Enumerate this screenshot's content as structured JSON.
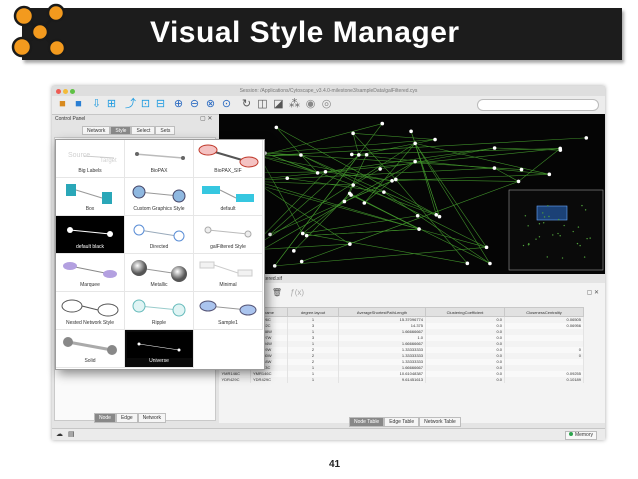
{
  "slide": {
    "title": "Visual Style Manager",
    "page_number": "41"
  },
  "window": {
    "title": "Session: /Applications/Cytoscape_v3.4.0-milestone3/sampleData/galFiltered.cys"
  },
  "control_panel": {
    "label": "Control Panel",
    "tabs": [
      "Network",
      "Style",
      "Select",
      "Sets"
    ],
    "bottom_tabs": [
      "Node",
      "Edge",
      "Network"
    ]
  },
  "styles": [
    {
      "label": "Big Labels",
      "preview": "big-labels"
    },
    {
      "label": "BioPAX",
      "preview": "biopax"
    },
    {
      "label": "BioPAX_SIF",
      "preview": "biopax-sif"
    },
    {
      "label": "Box",
      "preview": "box"
    },
    {
      "label": "Custom Graphics Style",
      "preview": "custom-graphics"
    },
    {
      "label": "default",
      "preview": "default"
    },
    {
      "label": "default black",
      "preview": "default-black"
    },
    {
      "label": "Directed",
      "preview": "directed"
    },
    {
      "label": "galFiltered Style",
      "preview": "galfiltered"
    },
    {
      "label": "Marquee",
      "preview": "marquee"
    },
    {
      "label": "Metallic",
      "preview": "metallic"
    },
    {
      "label": "Minimal",
      "preview": "minimal"
    },
    {
      "label": "Nested Network Style",
      "preview": "nested"
    },
    {
      "label": "Ripple",
      "preview": "ripple"
    },
    {
      "label": "Sample1",
      "preview": "sample1"
    },
    {
      "label": "Solid",
      "preview": "solid"
    },
    {
      "label": "Universe",
      "preview": "universe"
    }
  ],
  "network_view": {
    "tab_label": "Filtered.sif"
  },
  "table_panel": {
    "columns": [
      "name",
      "degree.layout",
      "AverageShortestPathLength",
      "ClusteringCoefficient",
      "ClosenessCentrality"
    ],
    "rows": [
      [
        "YKR026C",
        "YKR026C",
        "1",
        "15.37096774",
        "0.0",
        "0.06505"
      ],
      [
        "YGL122C",
        "YGL122C",
        "3",
        "14.375",
        "0.0",
        "0.06956"
      ],
      [
        "YDR138W",
        "YDR138W",
        "1",
        "1.66666667",
        "0.0",
        ""
      ],
      [
        "YGL097W",
        "YGL097W",
        "3",
        "1.0",
        "0.0",
        ""
      ],
      [
        "YDR204W",
        "YDR204W",
        "1",
        "1.66666667",
        "0.0",
        ""
      ],
      [
        "YLR249W",
        "YLR249W",
        "2",
        "1.33333333",
        "0.0",
        "0"
      ],
      [
        "YPR080W",
        "YPR080W",
        "2",
        "1.33333333",
        "0.0",
        "0"
      ],
      [
        "YBR118W",
        "YBR118W",
        "2",
        "1.33333333",
        "0.0",
        ""
      ],
      [
        "YLR293C",
        "YLR293C",
        "1",
        "1.66666667",
        "0.0",
        ""
      ],
      [
        "YMR146C",
        "YMR146C",
        "1",
        "10.61048387",
        "0.0",
        "0.09255"
      ],
      [
        "YDR429C",
        "YDR429C",
        "1",
        "9.61451613",
        "0.0",
        "0.10189"
      ]
    ],
    "tabs": [
      "Node Table",
      "Edge Table",
      "Network Table"
    ]
  },
  "status": {
    "memory": "Memory"
  },
  "colors": {
    "title_bar": "#1c1c1c",
    "network_bg": "#050505",
    "edge": "#3f8f2a",
    "node": "#ffffff",
    "selection_blue": "#2a6fd0"
  }
}
